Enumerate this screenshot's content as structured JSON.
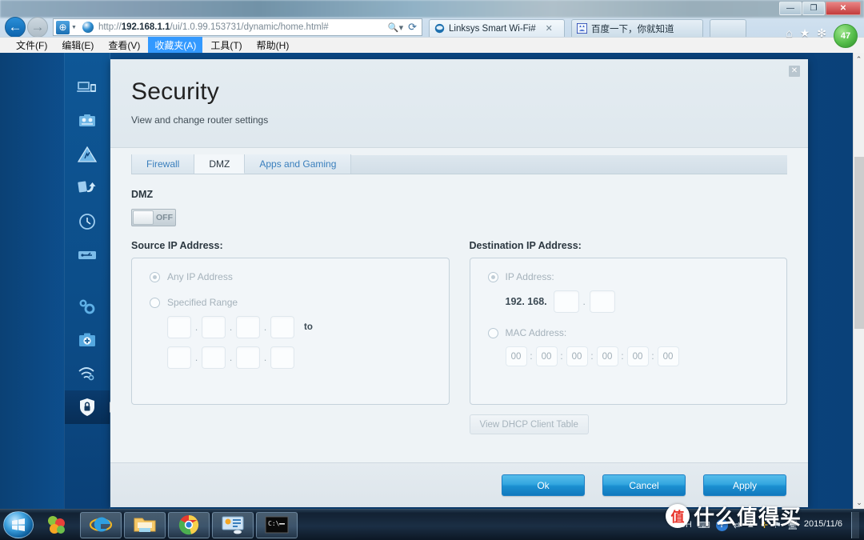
{
  "browser": {
    "window_controls": {
      "minimize": "—",
      "maximize": "❐",
      "close": "✕"
    },
    "nav": {
      "back": "←",
      "forward": "→"
    },
    "address": {
      "protocol_host": "http://",
      "host_bold": "192.168.1.1",
      "path": "/ui/1.0.99.153731/dynamic/home.html#",
      "search_icon": "search-icon",
      "refresh_icon": "refresh-icon",
      "compat_view_icon": "compatibility-view-icon"
    },
    "tabs": [
      {
        "label": "Linksys Smart Wi-Fi#",
        "close": "✕",
        "active": true
      },
      {
        "label": "百度一下，你就知道",
        "close": "",
        "active": false
      }
    ],
    "toolbar_icons": [
      "home-icon",
      "favorites-star-icon",
      "tools-gear-icon"
    ],
    "badge": "47",
    "menubar": [
      {
        "label": "文件(F)",
        "active": false
      },
      {
        "label": "编辑(E)",
        "active": false
      },
      {
        "label": "查看(V)",
        "active": false
      },
      {
        "label": "收藏夹(A)",
        "active": true
      },
      {
        "label": "工具(T)",
        "active": false
      },
      {
        "label": "帮助(H)",
        "active": false
      }
    ]
  },
  "sidebar": {
    "items": [
      {
        "name": "device-list-icon",
        "label": "Device List",
        "active": false
      },
      {
        "name": "parental-controls-icon",
        "label": "Parental Controls",
        "active": false
      },
      {
        "name": "media-prioritization-icon",
        "label": "Media Prioritization",
        "active": false
      },
      {
        "name": "speed-test-icon",
        "label": "Speed Test",
        "active": false
      },
      {
        "name": "external-storage-clock-icon",
        "label": "External Storage",
        "active": false
      },
      {
        "name": "usb-storage-icon",
        "label": "USB Storage",
        "active": false
      },
      {
        "name": "connectivity-gears-icon",
        "label": "Connectivity",
        "active": false
      },
      {
        "name": "troubleshooting-icon",
        "label": "Troubleshooting",
        "active": false
      },
      {
        "name": "wireless-icon",
        "label": "Wireless",
        "active": false
      },
      {
        "name": "security-shield-icon",
        "label": "Security",
        "active": true
      }
    ]
  },
  "modal": {
    "title": "Security",
    "subtitle": "View and change router settings",
    "close_label": "✕",
    "tabs": [
      {
        "label": "Firewall",
        "selected": false
      },
      {
        "label": "DMZ",
        "selected": true
      },
      {
        "label": "Apps and Gaming",
        "selected": false
      }
    ],
    "dmz": {
      "label": "DMZ",
      "state": "OFF",
      "enabled": false
    },
    "source": {
      "heading": "Source IP Address:",
      "options": [
        {
          "label": "Any IP Address",
          "selected": true
        },
        {
          "label": "Specified Range",
          "selected": false
        }
      ],
      "range_start": [
        "",
        "",
        "",
        ""
      ],
      "range_end": [
        "",
        "",
        "",
        ""
      ],
      "separator": ".",
      "to_label": "to"
    },
    "destination": {
      "heading": "Destination IP Address:",
      "options": [
        {
          "label": "IP Address:",
          "selected": true
        },
        {
          "label": "MAC Address:",
          "selected": false
        }
      ],
      "ip_prefix": "192. 168.",
      "ip_octets": [
        "",
        ""
      ],
      "ip_separator": ".",
      "mac_octets": [
        "00",
        "00",
        "00",
        "00",
        "00",
        "00"
      ],
      "mac_separator": ":"
    },
    "dhcp_button": "View DHCP Client Table",
    "footer_buttons": [
      {
        "label": "Ok",
        "name": "ok-button"
      },
      {
        "label": "Cancel",
        "name": "cancel-button"
      },
      {
        "label": "Apply",
        "name": "apply-button"
      }
    ]
  },
  "scrollbar": {
    "up": "⌃",
    "down": "⌄"
  },
  "taskbar": {
    "start": "start-orb",
    "pinned": [
      {
        "name": "taskbar-app-colors",
        "framed": false
      },
      {
        "name": "taskbar-internet-explorer",
        "framed": true
      },
      {
        "name": "taskbar-file-explorer",
        "framed": true
      },
      {
        "name": "taskbar-google-chrome",
        "framed": true
      },
      {
        "name": "taskbar-control-panel",
        "framed": true
      },
      {
        "name": "taskbar-command-prompt",
        "framed": true
      }
    ],
    "tray": [
      "CH",
      "input-method-icon",
      "help-icon",
      "network-icon",
      "show-hidden-icon",
      "security-shield-icon"
    ],
    "clock_date": "2015/11/6"
  },
  "watermark": {
    "logo": "值",
    "text": "什么值得买"
  },
  "colors": {
    "desktop_blue": "#0a4179",
    "accent_blue": "#1b8fd0",
    "modal_bg": "#eef3f6",
    "tab_link": "#3a7fbd",
    "disabled_text": "#a5b2bb"
  }
}
